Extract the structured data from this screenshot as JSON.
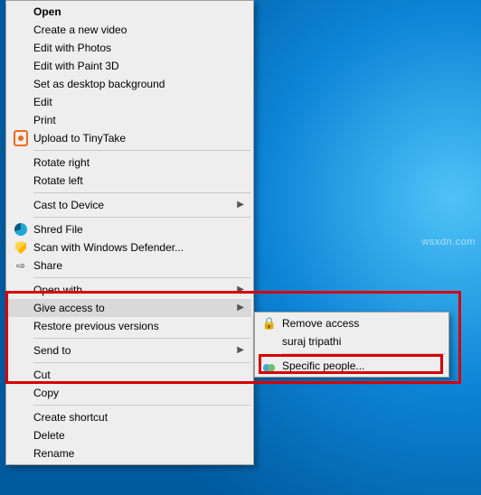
{
  "watermark": "wsxdn.com",
  "menu": {
    "open": "Open",
    "create_video": "Create a new video",
    "edit_photos": "Edit with Photos",
    "edit_paint3d": "Edit with Paint 3D",
    "set_bg": "Set as desktop background",
    "edit": "Edit",
    "print": "Print",
    "tinytake": "Upload to TinyTake",
    "rotate_right": "Rotate right",
    "rotate_left": "Rotate left",
    "cast": "Cast to Device",
    "shred": "Shred File",
    "defender": "Scan with Windows Defender...",
    "share": "Share",
    "open_with": "Open with",
    "give_access": "Give access to",
    "restore": "Restore previous versions",
    "send_to": "Send to",
    "cut": "Cut",
    "copy": "Copy",
    "shortcut": "Create shortcut",
    "delete": "Delete",
    "rename": "Rename"
  },
  "submenu": {
    "remove": "Remove access",
    "user": "suraj tripathi",
    "specific": "Specific people..."
  }
}
